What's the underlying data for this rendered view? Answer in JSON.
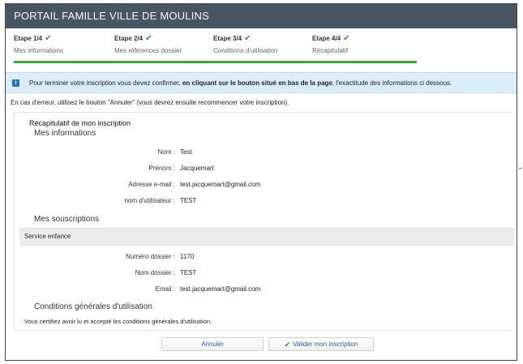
{
  "header": {
    "title": "PORTAIL FAMILLE VILLE DE MOULINS"
  },
  "steps": [
    {
      "label": "Etape 1/4",
      "sub": "Mes informations"
    },
    {
      "label": "Etape 2/4",
      "sub": "Mes références dossier"
    },
    {
      "label": "Etape 3/4",
      "sub": "Conditions d'utilisation"
    },
    {
      "label": "Etape 4/4",
      "sub": "Récapitulatif"
    }
  ],
  "progress": {
    "value": 1.0
  },
  "info": {
    "before": "Pour terminer votre inscription vous devez confirmer, ",
    "bold": "en cliquant sur le bouton situé en bas de la page",
    "after": ", l'exactitude des informations ci dessous."
  },
  "error_line": "En cas d'erreur, utilisez le bouton \"Annuler\" (vous devrez ensuite recommencer votre inscription).",
  "recap": {
    "title": "Récapitulatif de mon inscription",
    "mes_informations": {
      "heading": "Mes informations",
      "fields": [
        {
          "label": "Nom :",
          "value": "Test"
        },
        {
          "label": "Prénom :",
          "value": "Jacquemart"
        },
        {
          "label": "Adresse e-mail :",
          "value": "test.jacquemart@gmail.com"
        },
        {
          "label": "nom d'utilisateur :",
          "value": "TEST"
        }
      ]
    },
    "souscriptions": {
      "heading": "Mes souscriptions",
      "service": "Service enfance",
      "fields": [
        {
          "label": "Numéro dossier :",
          "value": "1170"
        },
        {
          "label": "Nom dossier :",
          "value": "TEST"
        },
        {
          "label": "Email :",
          "value": "test.jacquemart@gmail.com"
        }
      ]
    },
    "cgu": {
      "heading": "Conditions générales d'utilisation",
      "text": "Vous certifiez avoir lu et accepté les conditions générales d'utilisation."
    }
  },
  "buttons": {
    "cancel": "Annuler",
    "validate": "Valider mon inscription"
  },
  "colors": {
    "header_bg": "#4a5563",
    "check": "#2e9a2e",
    "progress": "#3aa53a",
    "info_bg": "#d9ecf8",
    "button_text": "#2f5f9f"
  },
  "icons": {
    "step_check": "check-icon",
    "info": "info-icon"
  }
}
